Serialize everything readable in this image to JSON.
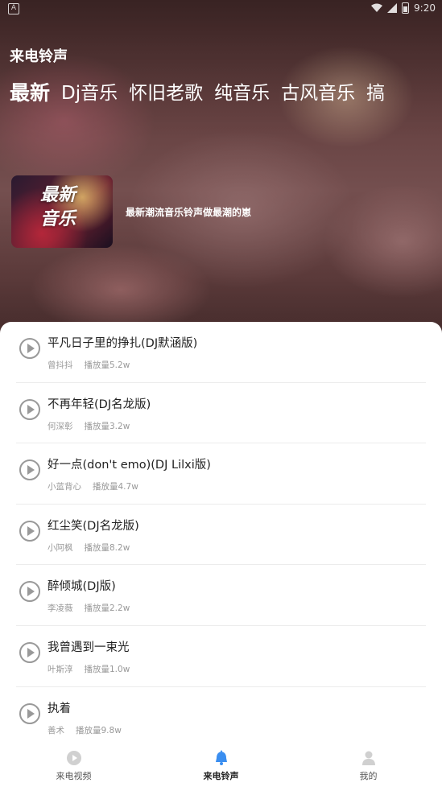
{
  "status_bar": {
    "time": "9:20"
  },
  "app_title": "来电铃声",
  "categories": [
    {
      "label": "最新",
      "active": true
    },
    {
      "label": "Dj音乐",
      "active": false
    },
    {
      "label": "怀旧老歌",
      "active": false
    },
    {
      "label": "纯音乐",
      "active": false
    },
    {
      "label": "古风音乐",
      "active": false
    },
    {
      "label": "搞",
      "active": false
    }
  ],
  "banner": {
    "cover_line1": "最新",
    "cover_line2": "音乐",
    "description": "最新潮流音乐铃声做最潮的崽"
  },
  "songs": [
    {
      "title": "平凡日子里的挣扎(DJ默涵版)",
      "artist": "曾抖抖",
      "plays": "播放量5.2w"
    },
    {
      "title": "不再年轻(DJ名龙版)",
      "artist": "何深彰",
      "plays": "播放量3.2w"
    },
    {
      "title": "好一点(don't emo)(DJ Lilxi版)",
      "artist": "小蓝背心",
      "plays": "播放量4.7w"
    },
    {
      "title": "红尘笑(DJ名龙版)",
      "artist": "小阿枫",
      "plays": "播放量8.2w"
    },
    {
      "title": "醉倾城(DJ版)",
      "artist": "李凌薇",
      "plays": "播放量2.2w"
    },
    {
      "title": "我曾遇到一束光",
      "artist": "叶斯淳",
      "plays": "播放量1.0w"
    },
    {
      "title": "执着",
      "artist": "善术",
      "plays": "播放量9.8w"
    }
  ],
  "bottom_nav": [
    {
      "label": "来电视频",
      "icon": "play-circle-icon",
      "active": false
    },
    {
      "label": "来电铃声",
      "icon": "bell-icon",
      "active": true
    },
    {
      "label": "我的",
      "icon": "user-icon",
      "active": false
    }
  ],
  "colors": {
    "accent": "#3a8ef0",
    "inactive_icon": "#cccccc",
    "text_secondary": "#999999"
  }
}
